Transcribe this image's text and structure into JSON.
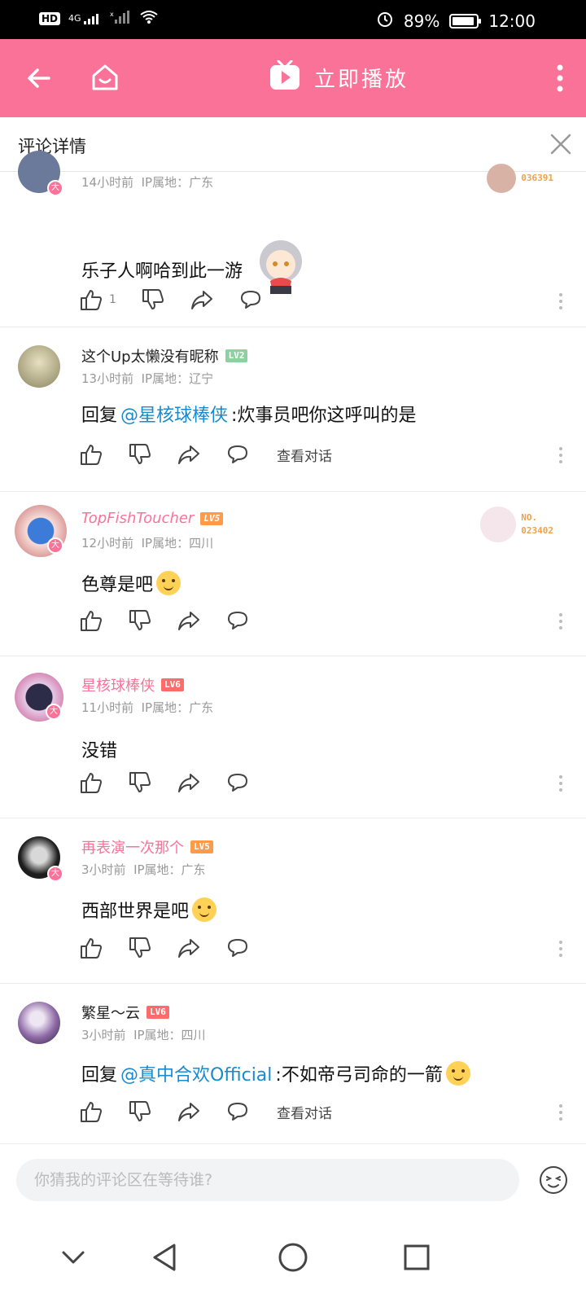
{
  "status_bar": {
    "network_badge": "HD",
    "signal_label": "4G",
    "battery": "89%",
    "battery_level": 0.89,
    "time": "12:00"
  },
  "app_bar": {
    "play_label": "立即播放",
    "icons": [
      "back-arrow-icon",
      "home-icon",
      "tv-play-icon",
      "more-vertical-icon"
    ],
    "background_color": "#fb7299"
  },
  "detail": {
    "title": "评论详情",
    "close_icon": "close-icon"
  },
  "comments": [
    {
      "meta": "14小时前  IP属地：广东",
      "body": "乐子人啊哈到此一游",
      "like_count": "1",
      "fan_no": "036391"
    },
    {
      "username": "这个Up太懒没有昵称",
      "level": "LV2",
      "meta": "13小时前  IP属地：辽宁",
      "reply_prefix": "回复 ",
      "mention": "@星核球棒侠",
      "body": ":炊事员吧你这呼叫的是",
      "view_conversation": "查看对话"
    },
    {
      "username": "TopFishToucher",
      "level": "LV5",
      "meta": "12小时前  IP属地：四川",
      "body": "色尊是吧",
      "fan_no_label": "NO.",
      "fan_no": "023402"
    },
    {
      "username": "星核球棒侠",
      "level": "LV6",
      "meta": "11小时前  IP属地：广东",
      "body": "没错"
    },
    {
      "username": "再表演一次那个",
      "level": "LV5",
      "meta": "3小时前  IP属地：广东",
      "body": "西部世界是吧"
    },
    {
      "username": "繁星～云",
      "level": "LV6",
      "meta": "3小时前  IP属地：四川",
      "reply_prefix": "回复 ",
      "mention": "@真中合欢Official",
      "body": ":不如帝弓司命的一箭",
      "view_conversation": "查看对话"
    }
  ],
  "input": {
    "placeholder": "你猜我的评论区在等待谁?"
  },
  "colors": {
    "accent": "#fb7299",
    "mention": "#178bcf",
    "lv2": "#8bd29e",
    "lv5": "#ff9a4a",
    "lv6": "#ff6b6b"
  }
}
